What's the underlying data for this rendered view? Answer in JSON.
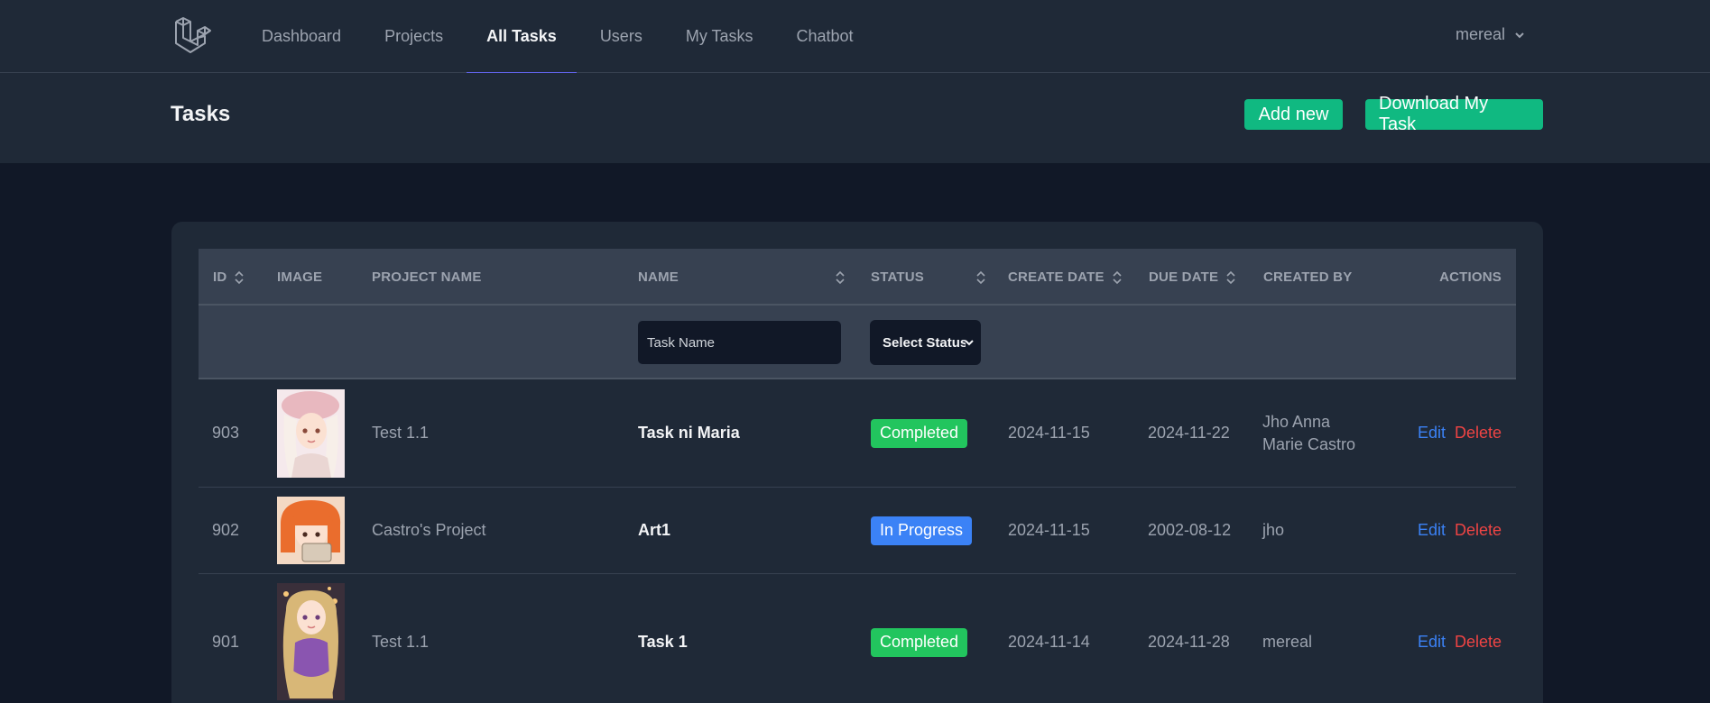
{
  "nav": {
    "items": [
      {
        "label": "Dashboard",
        "active": false
      },
      {
        "label": "Projects",
        "active": false
      },
      {
        "label": "All Tasks",
        "active": true
      },
      {
        "label": "Users",
        "active": false
      },
      {
        "label": "My Tasks",
        "active": false
      },
      {
        "label": "Chatbot",
        "active": false
      }
    ],
    "user": "mereal"
  },
  "header": {
    "title": "Tasks",
    "add_label": "Add new",
    "download_label": "Download My Task"
  },
  "table": {
    "columns": {
      "id": "ID",
      "image": "IMAGE",
      "project": "PROJECT NAME",
      "name": "NAME",
      "status": "STATUS",
      "create": "CREATE DATE",
      "due": "DUE DATE",
      "created_by": "CREATED BY",
      "actions": "ACTIONS"
    },
    "filters": {
      "task_name_placeholder": "Task Name",
      "status_select": "Select Status"
    },
    "rows": [
      {
        "id": "903",
        "project": "Test 1.1",
        "name": "Task ni Maria",
        "status": "Completed",
        "status_color": "#22c55e",
        "create": "2024-11-15",
        "due": "2024-11-22",
        "created_by": "Jho Anna Marie Castro",
        "edit": "Edit",
        "delete": "Delete"
      },
      {
        "id": "902",
        "project": "Castro's Project",
        "name": "Art1",
        "status": "In Progress",
        "status_color": "#3b82f6",
        "create": "2024-11-15",
        "due": "2002-08-12",
        "created_by": "jho",
        "edit": "Edit",
        "delete": "Delete"
      },
      {
        "id": "901",
        "project": "Test 1.1",
        "name": "Task 1",
        "status": "Completed",
        "status_color": "#22c55e",
        "create": "2024-11-14",
        "due": "2024-11-28",
        "created_by": "mereal",
        "edit": "Edit",
        "delete": "Delete"
      }
    ]
  }
}
